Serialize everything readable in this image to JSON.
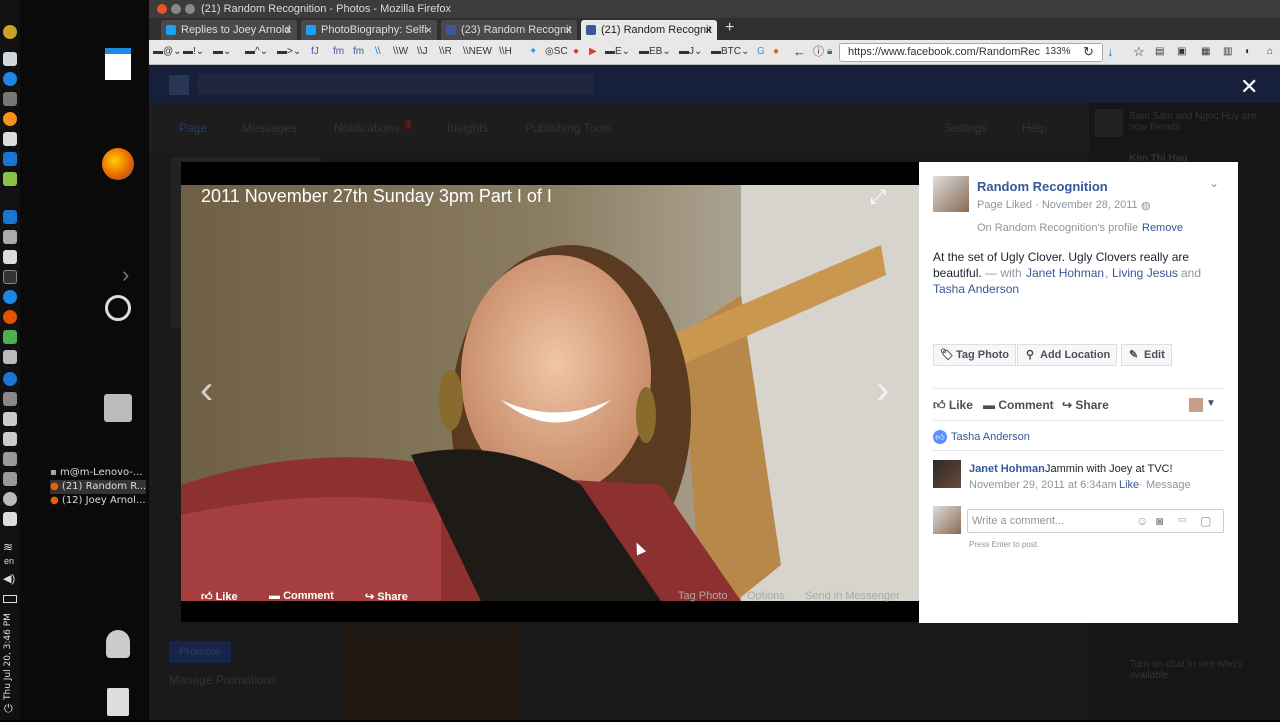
{
  "window": {
    "title": "(21) Random Recognition - Photos - Mozilla Firefox"
  },
  "tabs": [
    {
      "label": "Replies to Joey Arnold",
      "fav_color": "#1da1f2"
    },
    {
      "label": "PhotoBiography: Selfi",
      "fav_color": "#1da1f2"
    },
    {
      "label": "(23) Random Recognit",
      "fav_color": "#3b5998"
    },
    {
      "label": "(21) Random Recognit",
      "fav_color": "#3b5998"
    }
  ],
  "bookmarks": [
    "@",
    "!",
    "^",
    ">",
    "J",
    "m",
    "m",
    "W",
    "J",
    "R",
    "NEW",
    "H",
    "SC",
    "E",
    "EB",
    "J",
    "BTC",
    "G"
  ],
  "url": {
    "value": "https://www.facebook.com/RandomRec",
    "zoom": "133%"
  },
  "taskbar": {
    "windows": [
      "m@m-Lenovo-...",
      "(21) Random R...",
      "(12) Joey Arnol..."
    ],
    "lang": "en",
    "clock": "Thu Jul 20, 3:46 PM"
  },
  "fb": {
    "nav_items": [
      "Page",
      "Messages",
      "Notifications",
      "Insights",
      "Publishing Tools",
      "Settings",
      "Help"
    ],
    "notifications_count": "1",
    "promote_label": "Promote",
    "manage_promotions": "Manage Promotions",
    "ticker_1": "Sam Sam and Ngoc Huy are now friends.",
    "ticker_2": "Kim Thi Hau",
    "chat_hint": "Turn on chat to see who's available."
  },
  "photo": {
    "title": "2011 November 27th Sunday 3pm Part I of I",
    "actions": {
      "like": "Like",
      "comment": "Comment",
      "share": "Share"
    },
    "tools": {
      "tag": "Tag Photo",
      "options": "Options",
      "messenger": "Send in Messenger"
    }
  },
  "post": {
    "page_name": "Random Recognition",
    "meta": "Page Liked · November 28, 2011 ·",
    "profile_note": "On Random Recognition's profile ·",
    "remove": "Remove",
    "text_1": "At the set of Ugly Clover. Ugly Clovers really are",
    "text_2": "beautiful.",
    "with": "— with",
    "tag_1": "Janet Hohman",
    "tag_2": "Living Jesus",
    "and": "and",
    "tag_3": "Tasha Anderson",
    "buttons": {
      "tag": "Tag Photo",
      "location": "Add Location",
      "edit": "Edit"
    },
    "actions": {
      "like": "Like",
      "comment": "Comment",
      "share": "Share"
    },
    "liker": "Tasha Anderson",
    "comment": {
      "author": "Janet Hohman",
      "text": "Jammin with Joey at TVC!",
      "time": "November 29, 2011 at 6:34am",
      "like": "Like",
      "message": "Message"
    },
    "write_placeholder": "Write a comment...",
    "press_enter": "Press Enter to post."
  },
  "colors": {
    "fb_blue": "#365899",
    "brand": "#3b5998"
  }
}
